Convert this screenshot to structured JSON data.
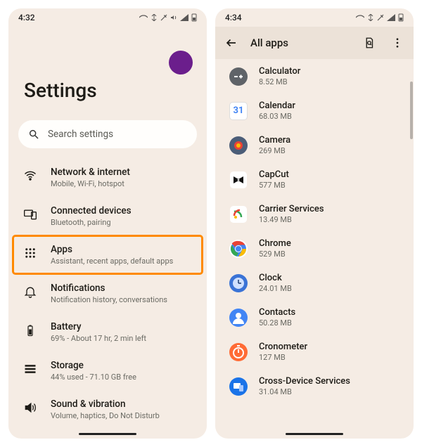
{
  "left": {
    "status": {
      "time": "4:32"
    },
    "title": "Settings",
    "search": {
      "placeholder": "Search settings"
    },
    "rows": [
      {
        "icon": "wifi",
        "name": "network",
        "title": "Network & internet",
        "sub": "Mobile, Wi-Fi, hotspot",
        "hl": false
      },
      {
        "icon": "devices",
        "name": "connected",
        "title": "Connected devices",
        "sub": "Bluetooth, pairing",
        "hl": false
      },
      {
        "icon": "apps",
        "name": "apps",
        "title": "Apps",
        "sub": "Assistant, recent apps, default apps",
        "hl": true
      },
      {
        "icon": "bell",
        "name": "notif",
        "title": "Notifications",
        "sub": "Notification history, conversations",
        "hl": false
      },
      {
        "icon": "battery",
        "name": "battery",
        "title": "Battery",
        "sub": "69% - About 17 hr, 2 min left",
        "hl": false
      },
      {
        "icon": "storage",
        "name": "storage",
        "title": "Storage",
        "sub": "44% used - 71.10 GB free",
        "hl": false
      },
      {
        "icon": "sound",
        "name": "sound",
        "title": "Sound & vibration",
        "sub": "Volume, haptics, Do Not Disturb",
        "hl": false
      }
    ]
  },
  "right": {
    "status": {
      "time": "4:34"
    },
    "topbar": {
      "title": "All apps"
    },
    "apps": [
      {
        "name": "Calculator",
        "sub": "8.52 MB",
        "bg": "#5f6368",
        "letter": "",
        "svg": "calc"
      },
      {
        "name": "Calendar",
        "sub": "68.03 MB",
        "bg": "#ffffff",
        "letter": "31",
        "fg": "#4285f4",
        "square": true
      },
      {
        "name": "Camera",
        "sub": "269 MB",
        "bg": "#4b5d78",
        "svg": "cam"
      },
      {
        "name": "CapCut",
        "sub": "577 MB",
        "bg": "#ffffff",
        "svg": "capcut"
      },
      {
        "name": "Carrier Services",
        "sub": "13.49 MB",
        "bg": "#ffffff",
        "svg": "carrier"
      },
      {
        "name": "Chrome",
        "sub": "529 MB",
        "bg": "#ffffff",
        "svg": "chrome"
      },
      {
        "name": "Clock",
        "sub": "24.01 MB",
        "bg": "#3a73d6",
        "svg": "clock"
      },
      {
        "name": "Contacts",
        "sub": "50.28 MB",
        "bg": "#4285f4",
        "svg": "contact"
      },
      {
        "name": "Cronometer",
        "sub": "127 MB",
        "bg": "#ff6b35",
        "svg": "crono"
      },
      {
        "name": "Cross-Device Services",
        "sub": "31.04 MB",
        "bg": "#1a73e8",
        "svg": "cross"
      }
    ]
  }
}
